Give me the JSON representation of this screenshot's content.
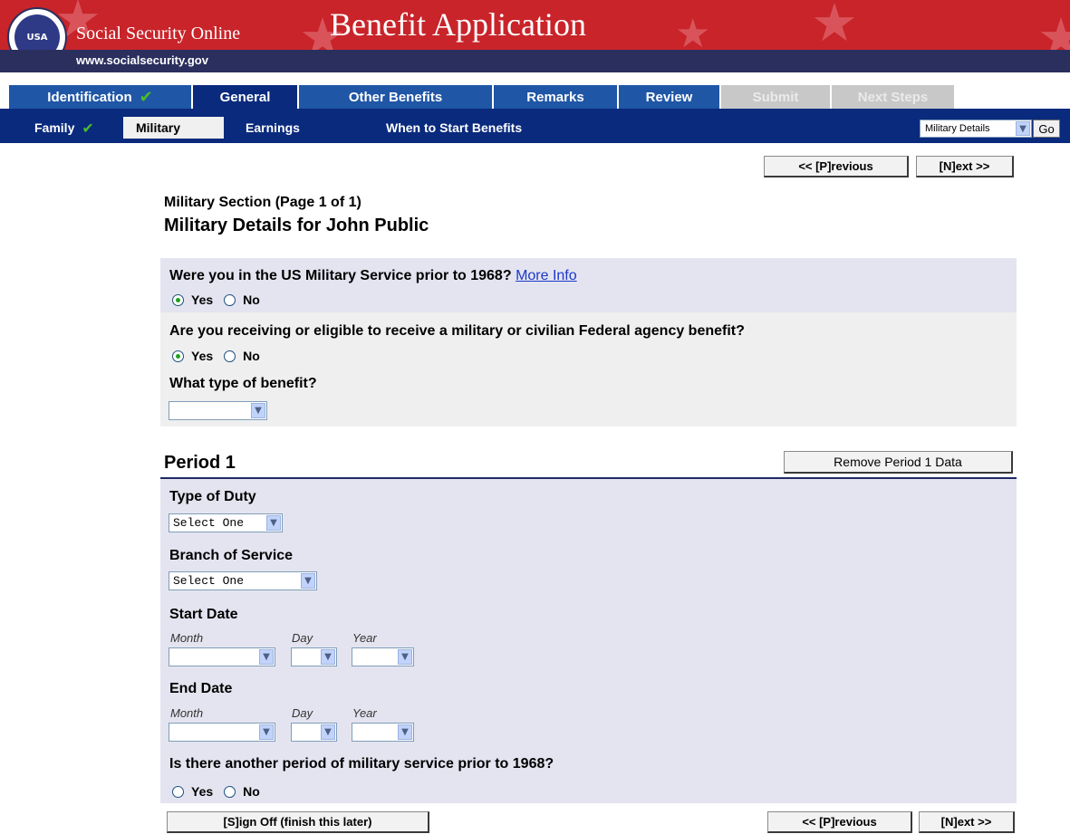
{
  "banner": {
    "site_name": "Social Security Online",
    "site_url": "www.socialsecurity.gov",
    "app_title": "Benefit Application",
    "seal_text": "USA"
  },
  "tabs": [
    {
      "label": "Identification",
      "state": "complete"
    },
    {
      "label": "General",
      "state": "active"
    },
    {
      "label": "Other Benefits",
      "state": "normal"
    },
    {
      "label": "Remarks",
      "state": "normal"
    },
    {
      "label": "Review",
      "state": "normal"
    },
    {
      "label": "Submit",
      "state": "disabled"
    },
    {
      "label": "Next Steps",
      "state": "disabled"
    }
  ],
  "subnav": {
    "items": [
      "Family",
      "Military",
      "Earnings",
      "When to Start Benefits"
    ],
    "jump_select": "Military Details",
    "go_label": "Go"
  },
  "nav": {
    "previous_label": "<< [P]revious",
    "next_label": "[N]ext >>",
    "signoff_label": "[S]ign Off (finish this later)"
  },
  "section": {
    "subtitle": "Military Section (Page 1 of 1)",
    "title": "Military Details for John Public"
  },
  "questions": {
    "q1": "Were you in the US Military Service prior to 1968?",
    "q1_link": "More Info",
    "q2": "Are you receiving or eligible to receive a military or civilian Federal agency benefit?",
    "q3": "What type of benefit?",
    "yes": "Yes",
    "no": "No"
  },
  "period": {
    "title": "Period 1",
    "remove_label": "Remove Period 1 Data",
    "type_of_duty_label": "Type of Duty",
    "type_of_duty_value": "Select One",
    "branch_label": "Branch of Service",
    "branch_value": "Select One",
    "start_date_label": "Start Date",
    "end_date_label": "End Date",
    "month": "Month",
    "day": "Day",
    "year": "Year",
    "another_label": "Is there another period of military service prior to 1968?"
  },
  "colors": {
    "banner_red": "#c8242a",
    "banner_navy": "#2b2f5e",
    "tab_blue": "#1f56a6",
    "tab_active": "#0a2a7d",
    "check_green": "#4cbb2c"
  }
}
